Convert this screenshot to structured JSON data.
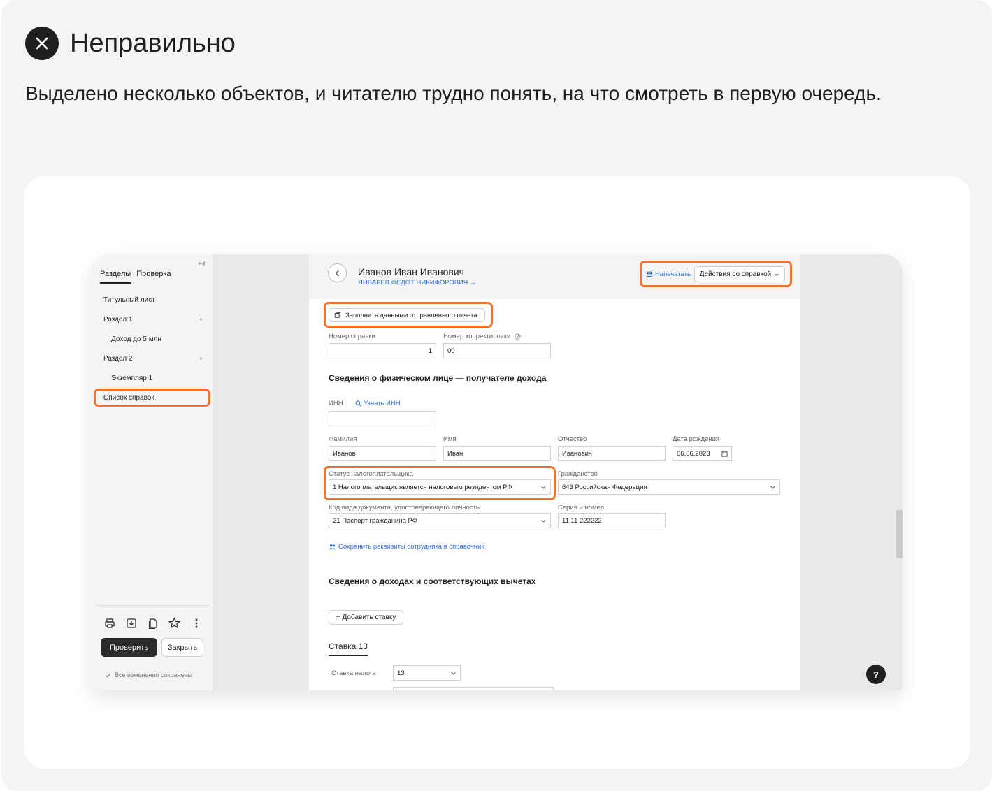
{
  "heading": "Неправильно",
  "description": "Выделено несколько объектов, и читателю трудно понять, на что смотреть в первую очередь.",
  "accent_color": "#f07330",
  "sidebar": {
    "tabs": [
      "Разделы",
      "Проверка"
    ],
    "items": [
      {
        "label": "Титульный лист"
      },
      {
        "label": "Раздел 1"
      },
      {
        "label": "Доход до 5 млн"
      },
      {
        "label": "Раздел 2"
      },
      {
        "label": "Экземпляр 1"
      },
      {
        "label": "Список справок"
      }
    ],
    "tool_icons": [
      "print-icon",
      "download-icon",
      "copy-icon",
      "star-icon",
      "more-vertical-icon"
    ],
    "check_button": "Проверить",
    "close_button": "Закрыть",
    "saved_status": "Все изменения сохранены"
  },
  "doc": {
    "person_name": "Иванов Иван Иванович",
    "person_link": "ЯНВАРЕВ ФЕДОТ НИКИФОРОВИЧ →",
    "print_label": "Напечатать",
    "actions_label": "Действия со справкой",
    "fill_button": "Заполнить данными отправленного отчета",
    "fields": {
      "cert_number_label": "Номер справки",
      "cert_number_value": "1",
      "correction_label": "Номер корректировки",
      "correction_value": "00",
      "section1_title": "Сведения о физическом лице — получателе дохода",
      "inn_label": "ИНН",
      "inn_link": "Узнать ИНН",
      "inn_value": "",
      "surname_label": "Фамилия",
      "surname_value": "Иванов",
      "name_label": "Имя",
      "name_value": "Иван",
      "patronymic_label": "Отчество",
      "patronymic_value": "Иванович",
      "birth_label": "Дата рождения",
      "birth_value": "06.06.2023",
      "status_label": "Статус налогоплательщика",
      "status_value": "1 Налогоплательщик является налоговым резидентом РФ",
      "citizenship_label": "Гражданство",
      "citizenship_value": "643 Российская Федерация",
      "doc_code_label": "Код вида документа, удостоверяющего личность",
      "doc_code_value": "21 Паспорт гражданина РФ",
      "series_label": "Серия и номер",
      "series_value": "11 11 222222",
      "save_link": "Сохранить реквизиты сотрудника в справочник",
      "section2_title": "Сведения о доходах и соответствующих вычетах",
      "add_rate": "Добавить ставку",
      "rate_tab": "Ставка 13",
      "tax_rate_label": "Ставка налога",
      "tax_rate_value": "13"
    }
  },
  "help_label": "?"
}
